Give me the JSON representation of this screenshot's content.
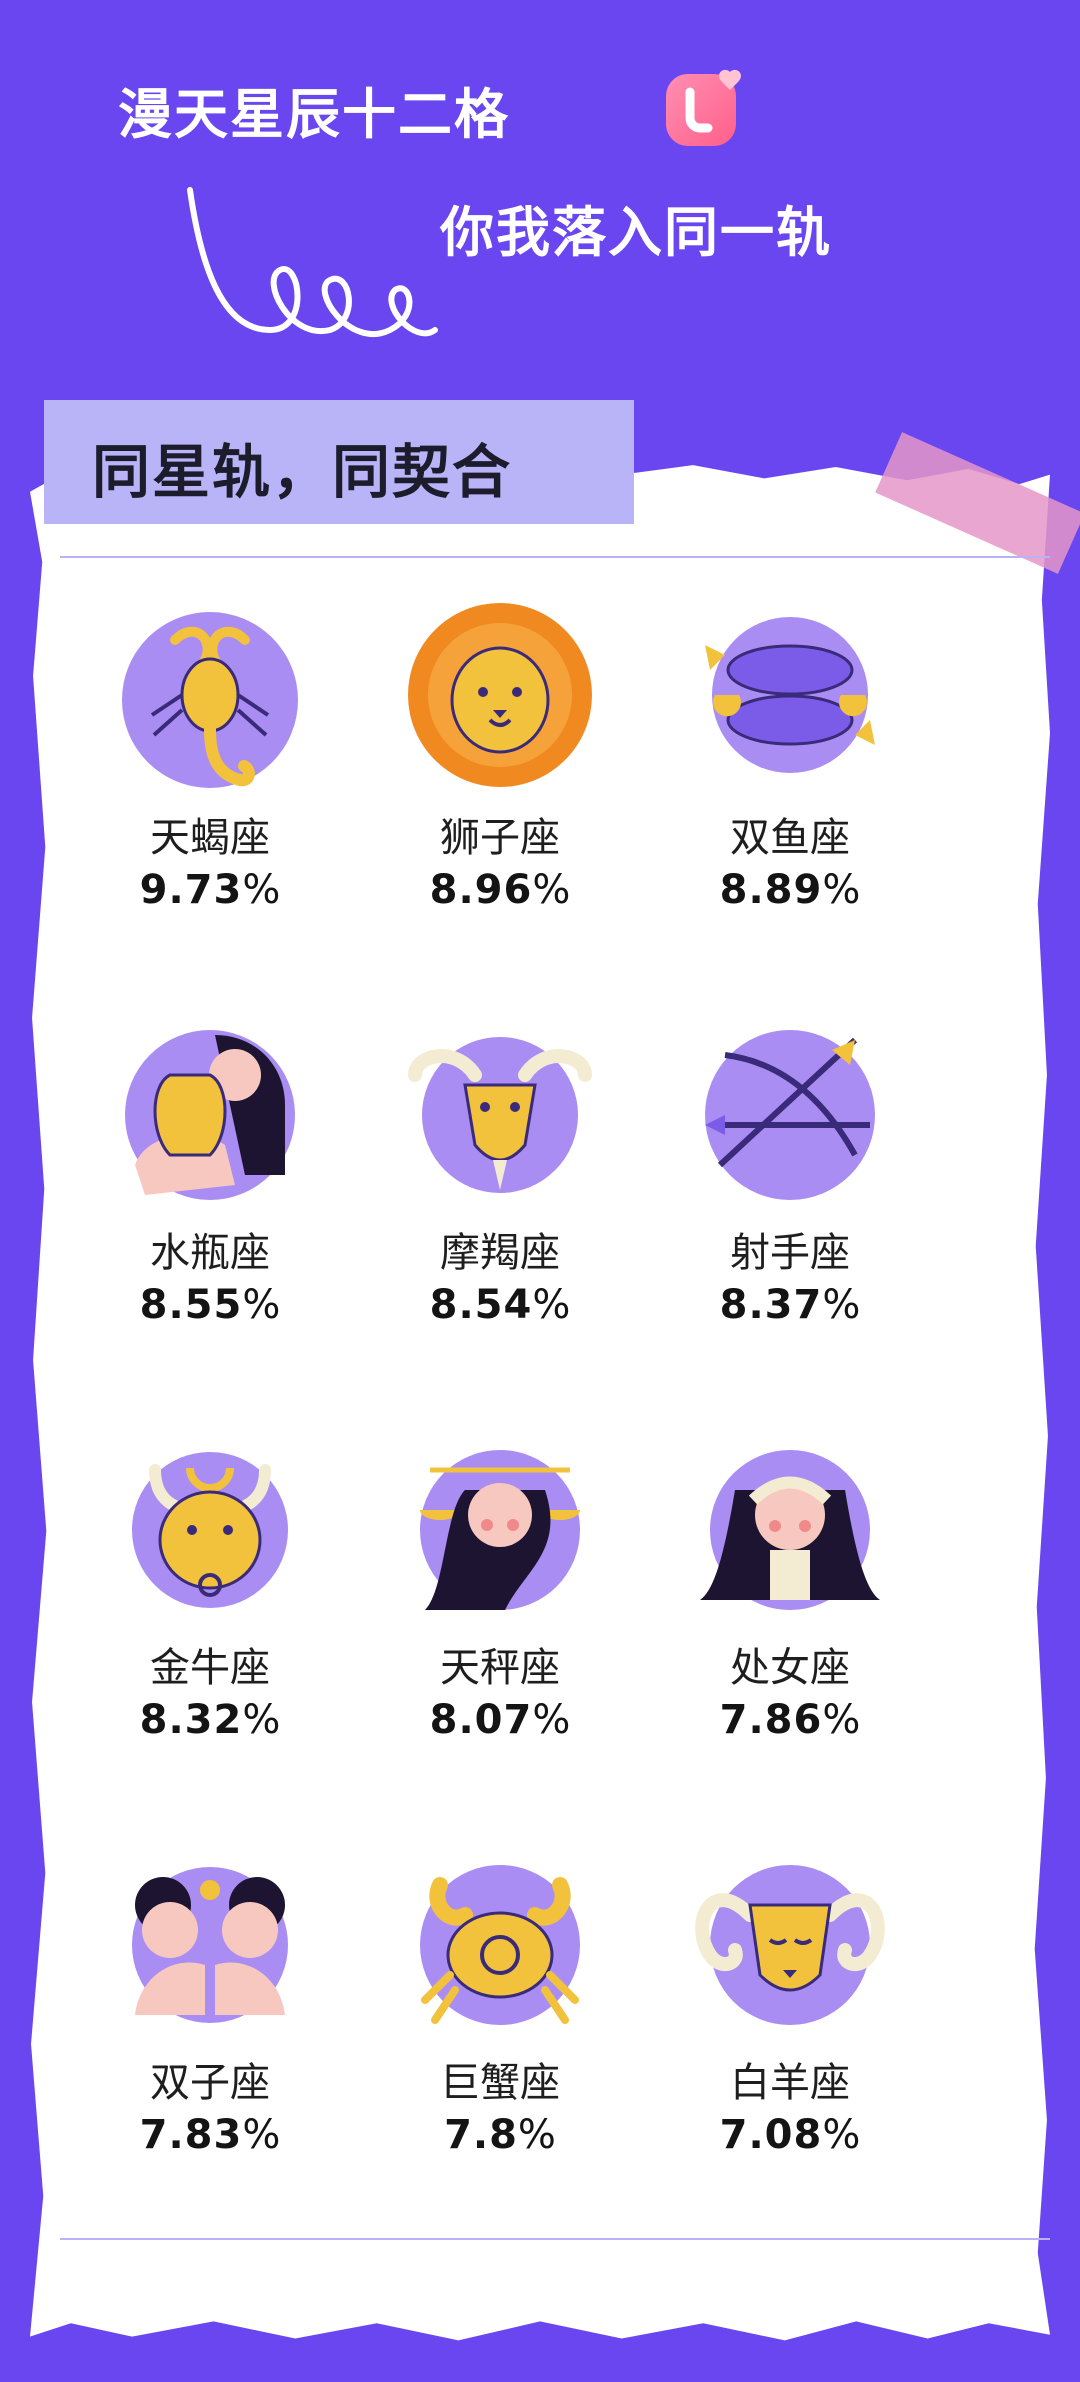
{
  "header": {
    "title_line1": "漫天星辰十二格",
    "title_line2": "你我落入同一轨",
    "logo_icon": "heart-chat-logo-icon"
  },
  "section": {
    "subtitle": "同星轨，同契合"
  },
  "colors": {
    "background": "#6a46f0",
    "card": "#ffffff",
    "accent_lavender": "#b9b4f7",
    "emblem_purple": "#a98df2",
    "gold": "#f2c23d"
  },
  "zodiac": [
    {
      "name": "天蝎座",
      "percent": "9.73",
      "sign": "%",
      "icon": "scorpion-icon"
    },
    {
      "name": "狮子座",
      "percent": "8.96",
      "sign": "%",
      "icon": "lion-icon"
    },
    {
      "name": "双鱼座",
      "percent": "8.89",
      "sign": "%",
      "icon": "fish-icon"
    },
    {
      "name": "水瓶座",
      "percent": "8.55",
      "sign": "%",
      "icon": "water-bearer-icon"
    },
    {
      "name": "摩羯座",
      "percent": "8.54",
      "sign": "%",
      "icon": "goat-icon"
    },
    {
      "name": "射手座",
      "percent": "8.37",
      "sign": "%",
      "icon": "bow-arrow-icon"
    },
    {
      "name": "金牛座",
      "percent": "8.32",
      "sign": "%",
      "icon": "bull-icon"
    },
    {
      "name": "天秤座",
      "percent": "8.07",
      "sign": "%",
      "icon": "scales-icon"
    },
    {
      "name": "处女座",
      "percent": "7.86",
      "sign": "%",
      "icon": "maiden-icon"
    },
    {
      "name": "双子座",
      "percent": "7.83",
      "sign": "%",
      "icon": "twins-icon"
    },
    {
      "name": "巨蟹座",
      "percent": "7.8",
      "sign": "%",
      "icon": "crab-icon"
    },
    {
      "name": "白羊座",
      "percent": "7.08",
      "sign": "%",
      "icon": "ram-icon"
    }
  ]
}
